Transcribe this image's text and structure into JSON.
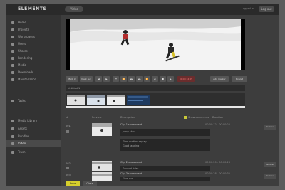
{
  "app": {
    "brand": "ELEMENTS",
    "top_pill": "Video",
    "top_right_text": "Logged in",
    "top_button": "Log out"
  },
  "sidebar": {
    "items": [
      {
        "label": "Home",
        "icon": "home-icon"
      },
      {
        "label": "Projects",
        "icon": "folder-icon"
      },
      {
        "label": "Workspaces",
        "icon": "workspace-icon"
      },
      {
        "label": "Users",
        "icon": "user-icon"
      },
      {
        "label": "Shares",
        "icon": "share-icon"
      },
      {
        "label": "Rendering",
        "icon": "render-icon"
      },
      {
        "label": "Media",
        "icon": "media-icon"
      },
      {
        "label": "Downloads",
        "icon": "download-icon"
      },
      {
        "label": "Maintenance",
        "icon": "wrench-icon"
      },
      {
        "label": "Tasks",
        "icon": "task-icon"
      },
      {
        "label": "Media Library",
        "icon": "library-icon"
      },
      {
        "label": "Assets",
        "icon": "asset-icon"
      },
      {
        "label": "Bundles",
        "icon": "bundle-icon"
      },
      {
        "label": "Video",
        "icon": "video-icon",
        "active": true
      },
      {
        "label": "Trash",
        "icon": "trash-icon"
      }
    ]
  },
  "controls": {
    "buttons": [
      "Mark in",
      "Mark out",
      "◀",
      "▶",
      "⏮",
      "⏪",
      "◀◀",
      "▶▶",
      "⏩",
      "⏭",
      "■",
      "▶",
      "00:00:12:05",
      "Add marker",
      "Export"
    ]
  },
  "label_field": {
    "value": "Untitled 1"
  },
  "table": {
    "headers": [
      "#",
      "Preview",
      "Description",
      "Show comments",
      "Duration"
    ]
  },
  "rows": [
    {
      "num": "001",
      "title": "Clip 1 snowboard",
      "meta": "00:00:12 - 00:00:20",
      "button": "Remove",
      "comments": [
        "Jump start",
        "Slow motion replay",
        "Good landing"
      ]
    },
    {
      "num": "002",
      "title": "Clip 2 snowboard",
      "meta": "00:00:20 - 00:00:28",
      "button": "Remove",
      "comments": [
        "Second rider"
      ]
    },
    {
      "num": "003",
      "title": "Clip 3 snowboard",
      "meta": "00:00:28 - 00:00:35",
      "button": "Remove",
      "comments": [
        "Final run"
      ]
    }
  ],
  "bottom": {
    "save": "Save",
    "secondary": "Close"
  }
}
